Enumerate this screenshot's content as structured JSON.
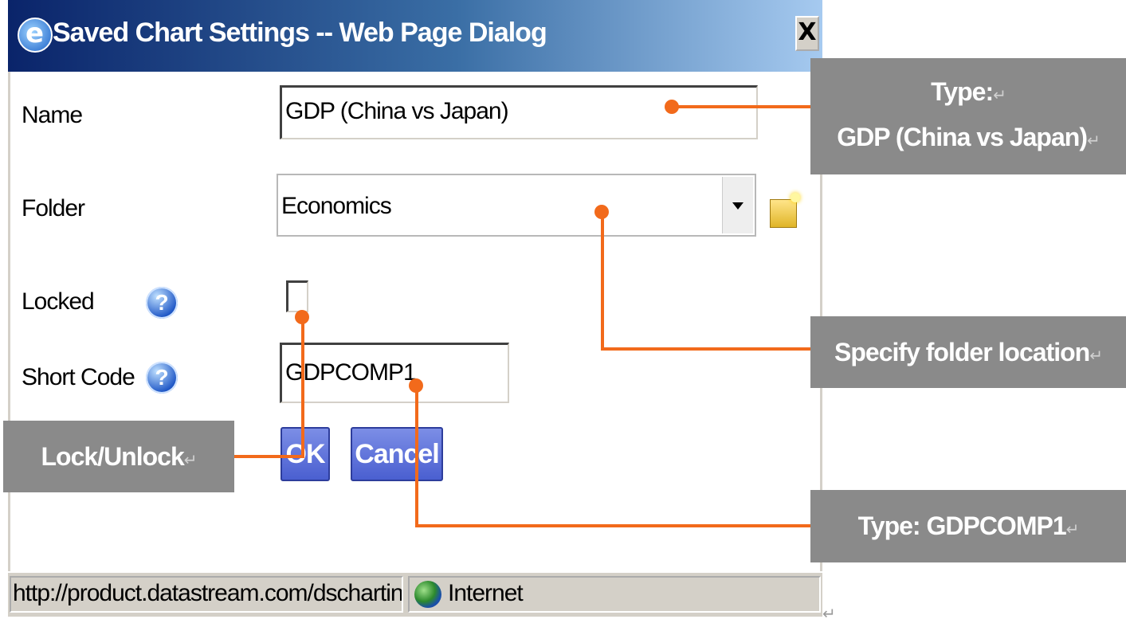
{
  "dialog": {
    "title": "Saved Chart Settings -- Web Page Dialog",
    "close_label": "X",
    "fields": {
      "name_label": "Name",
      "name_value": "GDP (China vs Japan)",
      "folder_label": "Folder",
      "folder_value": "Economics",
      "locked_label": "Locked",
      "locked_checked": false,
      "shortcode_label": "Short Code",
      "shortcode_value": "GDPCOMP1",
      "help_glyph": "?"
    },
    "buttons": {
      "ok": "OK",
      "cancel": "Cancel"
    },
    "statusbar": {
      "url": "http://product.datastream.com/dschartin",
      "zone": "Internet"
    }
  },
  "callouts": {
    "name_line1": "Type:",
    "name_line2": "GDP (China vs Japan)",
    "folder": "Specify folder location",
    "lock": "Lock/Unlock",
    "shortcode": "Type: GDPCOMP1",
    "para_mark": "↵"
  },
  "colors": {
    "callout_bg": "#8a8a8a",
    "connector": "#f26a1b",
    "button_blue": "#4a5fd0",
    "titlebar_dark": "#0a246a"
  }
}
